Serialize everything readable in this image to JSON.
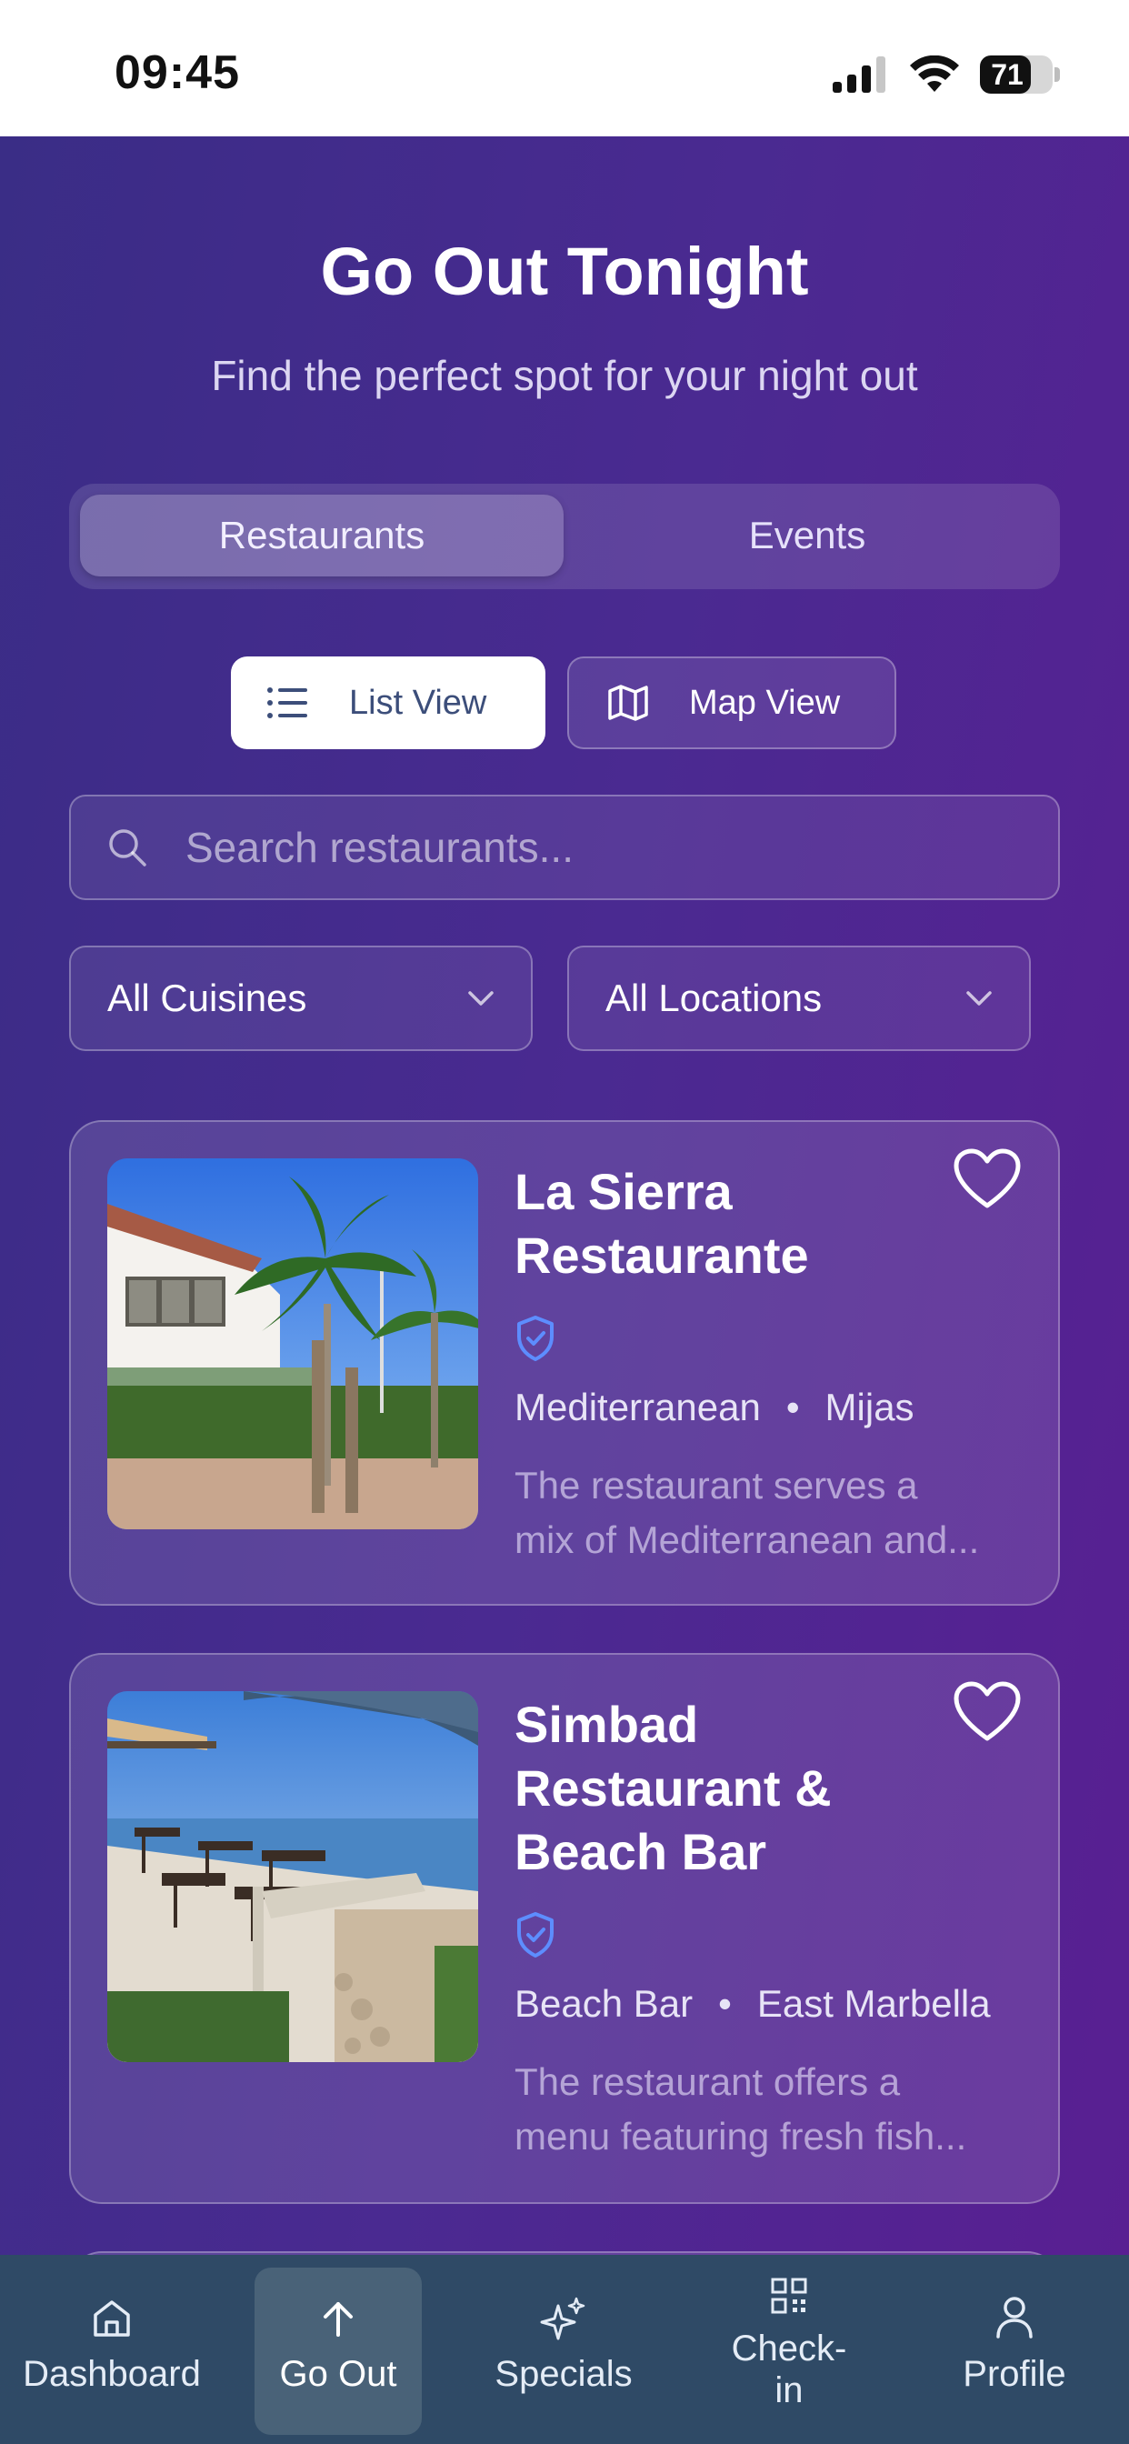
{
  "status_bar": {
    "time": "09:45",
    "battery": "71"
  },
  "header": {
    "title": "Go Out Tonight",
    "subtitle": "Find the perfect spot for your night out"
  },
  "segments": [
    {
      "label": "Restaurants",
      "active": true
    },
    {
      "label": "Events",
      "active": false
    }
  ],
  "view_toggle": {
    "list_label": "List View",
    "map_label": "Map View",
    "active": "list"
  },
  "search": {
    "placeholder": "Search restaurants..."
  },
  "filters": {
    "cuisine": "All Cuisines",
    "location": "All Locations"
  },
  "restaurants": [
    {
      "name_line1": "La Sierra",
      "name_line2": "Restaurante",
      "cuisine": "Mediterranean",
      "location": "Mijas",
      "desc_line1": "The restaurant serves a",
      "desc_line2": "mix of Mediterranean and...",
      "verified": true
    },
    {
      "name_line1": "Simbad",
      "name_line2": "Restaurant &",
      "name_line3": "Beach Bar",
      "cuisine": "Beach Bar",
      "location": "East Marbella",
      "desc_line1": "The restaurant offers a",
      "desc_line2": "menu featuring fresh fish...",
      "verified": true
    }
  ],
  "bottom_nav": [
    {
      "label": "Dashboard",
      "icon": "home-icon"
    },
    {
      "label": "Go Out",
      "icon": "arrow-up-icon",
      "active": true
    },
    {
      "label": "Specials",
      "icon": "sparkles-icon"
    },
    {
      "label_line1": "Check-",
      "label_line2": "in",
      "icon": "qr-code-icon"
    },
    {
      "label": "Profile",
      "icon": "user-icon"
    }
  ],
  "colors": {
    "gradient_start": "#3a2d86",
    "gradient_end": "#591f92",
    "nav_bg": "#2f4a66",
    "verified_badge": "#5d8dff"
  }
}
